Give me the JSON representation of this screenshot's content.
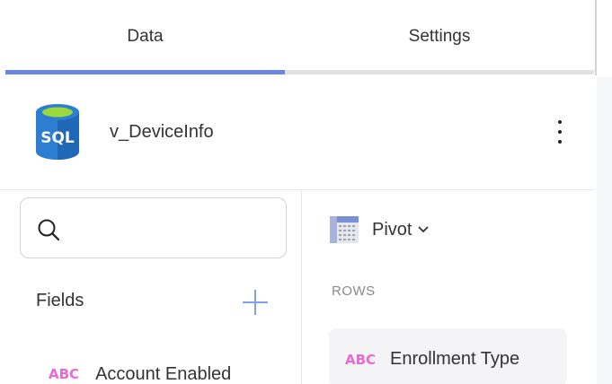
{
  "tabs": [
    {
      "label": "Data",
      "active": true
    },
    {
      "label": "Settings",
      "active": false
    }
  ],
  "source": {
    "icon": "sql-database-icon",
    "icon_text": "SQL",
    "name": "v_DeviceInfo",
    "menu_icon": "kebab-menu-icon"
  },
  "search": {
    "placeholder": "",
    "value": "",
    "icon": "search-icon"
  },
  "fields": {
    "label": "Fields",
    "add_icon": "plus-icon",
    "items": [
      {
        "type_badge": "ABC",
        "name": "Account Enabled"
      }
    ]
  },
  "pivot": {
    "label": "Pivot",
    "icon": "pivot-table-icon"
  },
  "rows": {
    "label": "ROWS",
    "items": [
      {
        "type_badge": "ABC",
        "name": "Enrollment Type"
      }
    ]
  },
  "colors": {
    "accent": "#6b87e6",
    "type_badge": "#e86ad8",
    "sql_icon": "#2d7dd2",
    "sql_icon_top": "#9bd83b"
  }
}
